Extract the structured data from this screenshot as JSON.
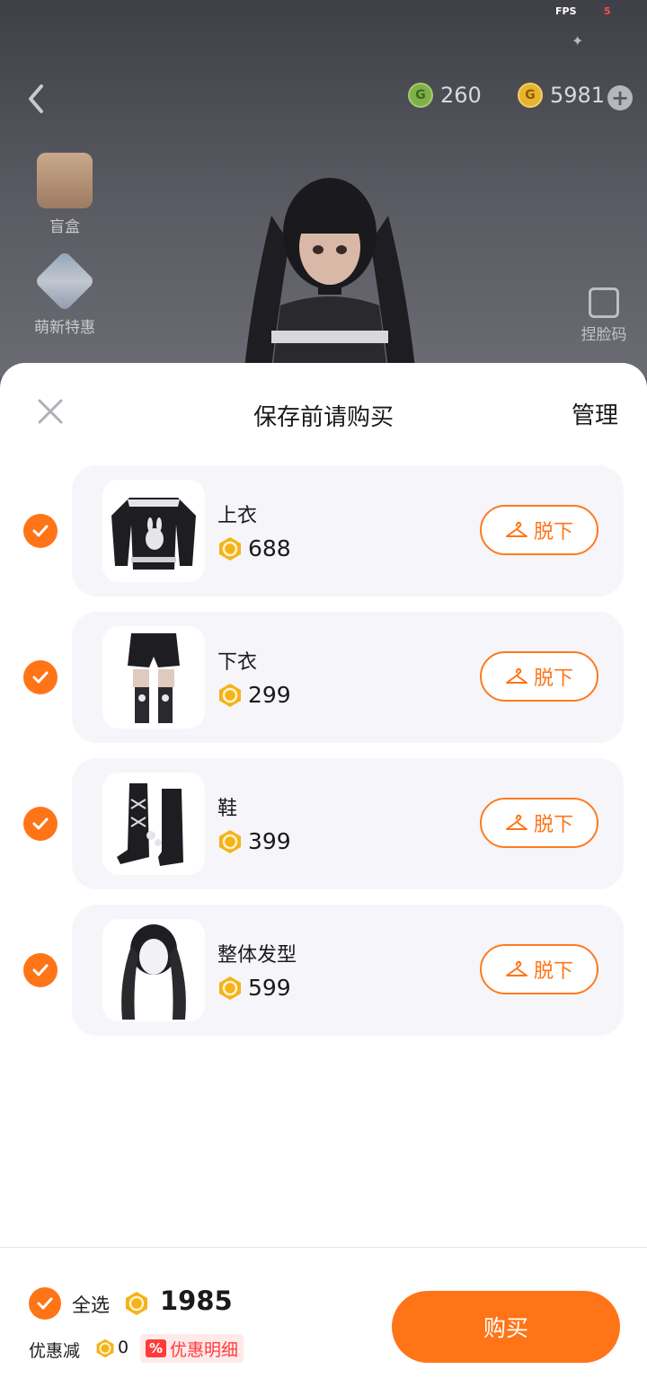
{
  "status": {
    "fps_label": "FPS",
    "fps_value": "5"
  },
  "header": {
    "green_currency": "260",
    "gold_currency": "5981"
  },
  "side_menu": [
    {
      "label": "盲盒",
      "icon": "gift-box-icon"
    },
    {
      "label": "萌新特惠",
      "icon": "newbie-offer-icon"
    }
  ],
  "face_code_label": "捏脸码",
  "sheet": {
    "title": "保存前请购买",
    "manage_label": "管理",
    "items": [
      {
        "name": "上衣",
        "price": "688",
        "remove_label": "脱下",
        "checked": true
      },
      {
        "name": "下衣",
        "price": "299",
        "remove_label": "脱下",
        "checked": true
      },
      {
        "name": "鞋",
        "price": "399",
        "remove_label": "脱下",
        "checked": true
      },
      {
        "name": "整体发型",
        "price": "599",
        "remove_label": "脱下",
        "checked": true
      }
    ]
  },
  "footer": {
    "select_all_label": "全选",
    "total": "1985",
    "discount_label": "优惠减",
    "discount_value": "0",
    "promo_tag": "%",
    "promo_label": "优惠明细",
    "buy_label": "购买"
  },
  "colors": {
    "accent": "#ff7417",
    "promo_red": "#ff3b3b",
    "card_bg": "#f6f5f9"
  }
}
